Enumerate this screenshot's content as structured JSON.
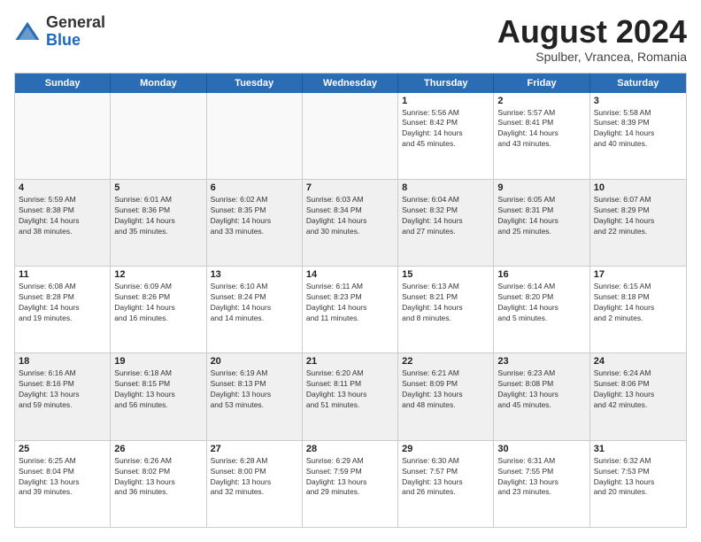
{
  "header": {
    "logo_general": "General",
    "logo_blue": "Blue",
    "month_title": "August 2024",
    "location": "Spulber, Vrancea, Romania"
  },
  "weekdays": [
    "Sunday",
    "Monday",
    "Tuesday",
    "Wednesday",
    "Thursday",
    "Friday",
    "Saturday"
  ],
  "rows": [
    [
      {
        "day": "",
        "info": ""
      },
      {
        "day": "",
        "info": ""
      },
      {
        "day": "",
        "info": ""
      },
      {
        "day": "",
        "info": ""
      },
      {
        "day": "1",
        "info": "Sunrise: 5:56 AM\nSunset: 8:42 PM\nDaylight: 14 hours\nand 45 minutes."
      },
      {
        "day": "2",
        "info": "Sunrise: 5:57 AM\nSunset: 8:41 PM\nDaylight: 14 hours\nand 43 minutes."
      },
      {
        "day": "3",
        "info": "Sunrise: 5:58 AM\nSunset: 8:39 PM\nDaylight: 14 hours\nand 40 minutes."
      }
    ],
    [
      {
        "day": "4",
        "info": "Sunrise: 5:59 AM\nSunset: 8:38 PM\nDaylight: 14 hours\nand 38 minutes."
      },
      {
        "day": "5",
        "info": "Sunrise: 6:01 AM\nSunset: 8:36 PM\nDaylight: 14 hours\nand 35 minutes."
      },
      {
        "day": "6",
        "info": "Sunrise: 6:02 AM\nSunset: 8:35 PM\nDaylight: 14 hours\nand 33 minutes."
      },
      {
        "day": "7",
        "info": "Sunrise: 6:03 AM\nSunset: 8:34 PM\nDaylight: 14 hours\nand 30 minutes."
      },
      {
        "day": "8",
        "info": "Sunrise: 6:04 AM\nSunset: 8:32 PM\nDaylight: 14 hours\nand 27 minutes."
      },
      {
        "day": "9",
        "info": "Sunrise: 6:05 AM\nSunset: 8:31 PM\nDaylight: 14 hours\nand 25 minutes."
      },
      {
        "day": "10",
        "info": "Sunrise: 6:07 AM\nSunset: 8:29 PM\nDaylight: 14 hours\nand 22 minutes."
      }
    ],
    [
      {
        "day": "11",
        "info": "Sunrise: 6:08 AM\nSunset: 8:28 PM\nDaylight: 14 hours\nand 19 minutes."
      },
      {
        "day": "12",
        "info": "Sunrise: 6:09 AM\nSunset: 8:26 PM\nDaylight: 14 hours\nand 16 minutes."
      },
      {
        "day": "13",
        "info": "Sunrise: 6:10 AM\nSunset: 8:24 PM\nDaylight: 14 hours\nand 14 minutes."
      },
      {
        "day": "14",
        "info": "Sunrise: 6:11 AM\nSunset: 8:23 PM\nDaylight: 14 hours\nand 11 minutes."
      },
      {
        "day": "15",
        "info": "Sunrise: 6:13 AM\nSunset: 8:21 PM\nDaylight: 14 hours\nand 8 minutes."
      },
      {
        "day": "16",
        "info": "Sunrise: 6:14 AM\nSunset: 8:20 PM\nDaylight: 14 hours\nand 5 minutes."
      },
      {
        "day": "17",
        "info": "Sunrise: 6:15 AM\nSunset: 8:18 PM\nDaylight: 14 hours\nand 2 minutes."
      }
    ],
    [
      {
        "day": "18",
        "info": "Sunrise: 6:16 AM\nSunset: 8:16 PM\nDaylight: 13 hours\nand 59 minutes."
      },
      {
        "day": "19",
        "info": "Sunrise: 6:18 AM\nSunset: 8:15 PM\nDaylight: 13 hours\nand 56 minutes."
      },
      {
        "day": "20",
        "info": "Sunrise: 6:19 AM\nSunset: 8:13 PM\nDaylight: 13 hours\nand 53 minutes."
      },
      {
        "day": "21",
        "info": "Sunrise: 6:20 AM\nSunset: 8:11 PM\nDaylight: 13 hours\nand 51 minutes."
      },
      {
        "day": "22",
        "info": "Sunrise: 6:21 AM\nSunset: 8:09 PM\nDaylight: 13 hours\nand 48 minutes."
      },
      {
        "day": "23",
        "info": "Sunrise: 6:23 AM\nSunset: 8:08 PM\nDaylight: 13 hours\nand 45 minutes."
      },
      {
        "day": "24",
        "info": "Sunrise: 6:24 AM\nSunset: 8:06 PM\nDaylight: 13 hours\nand 42 minutes."
      }
    ],
    [
      {
        "day": "25",
        "info": "Sunrise: 6:25 AM\nSunset: 8:04 PM\nDaylight: 13 hours\nand 39 minutes."
      },
      {
        "day": "26",
        "info": "Sunrise: 6:26 AM\nSunset: 8:02 PM\nDaylight: 13 hours\nand 36 minutes."
      },
      {
        "day": "27",
        "info": "Sunrise: 6:28 AM\nSunset: 8:00 PM\nDaylight: 13 hours\nand 32 minutes."
      },
      {
        "day": "28",
        "info": "Sunrise: 6:29 AM\nSunset: 7:59 PM\nDaylight: 13 hours\nand 29 minutes."
      },
      {
        "day": "29",
        "info": "Sunrise: 6:30 AM\nSunset: 7:57 PM\nDaylight: 13 hours\nand 26 minutes."
      },
      {
        "day": "30",
        "info": "Sunrise: 6:31 AM\nSunset: 7:55 PM\nDaylight: 13 hours\nand 23 minutes."
      },
      {
        "day": "31",
        "info": "Sunrise: 6:32 AM\nSunset: 7:53 PM\nDaylight: 13 hours\nand 20 minutes."
      }
    ]
  ]
}
